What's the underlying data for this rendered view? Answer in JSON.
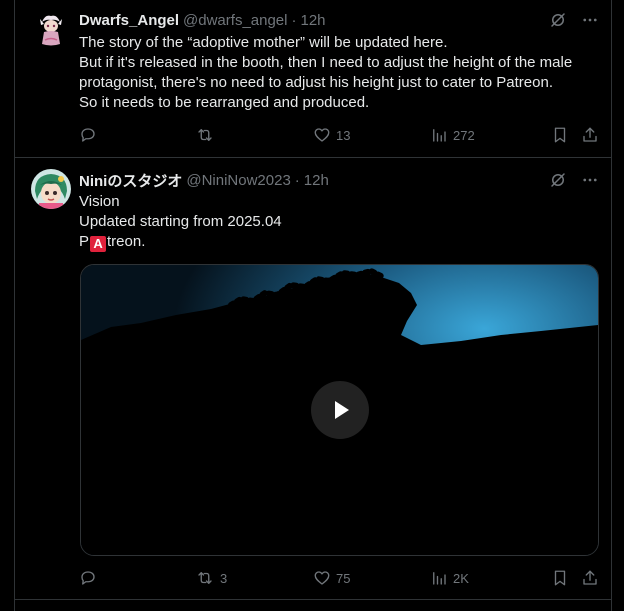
{
  "tweets": [
    {
      "name": "Dwarfs_Angel",
      "handle": "@dwarfs_angel",
      "dot": "·",
      "time": "12h",
      "lines": [
        "The story of the “adoptive mother” will be updated here.",
        "But if it's released in the booth, then I need to adjust the height of the male",
        "protagonist, there's no need to adjust his height just to cater to Patreon.",
        "So it needs to be rearranged and produced."
      ],
      "reply_count": "",
      "repost_count": "",
      "like_count": "13",
      "view_count": "272"
    },
    {
      "name": "Niniのスタジオ",
      "handle": "@NiniNow2023",
      "dot": "·",
      "time": "12h",
      "line1": "Vision",
      "line2": "Updated starting from 2025.04",
      "line3_prefix": "P",
      "line3_badge": "A",
      "line3_suffix": "treon.",
      "reply_count": "",
      "repost_count": "3",
      "like_count": "75",
      "view_count": "2K"
    }
  ],
  "icons": {
    "grok": "grok-icon",
    "more": "more-icon",
    "reply": "reply-icon",
    "repost": "repost-icon",
    "like": "heart-icon",
    "views": "views-icon",
    "bookmark": "bookmark-icon",
    "share": "share-icon",
    "play": "play-icon"
  },
  "colors": {
    "background": "#000000",
    "text": "#e7e9ea",
    "muted": "#71767b",
    "border": "#2f3336",
    "badge": "#e0223c",
    "sky": "#3aa0d0"
  }
}
